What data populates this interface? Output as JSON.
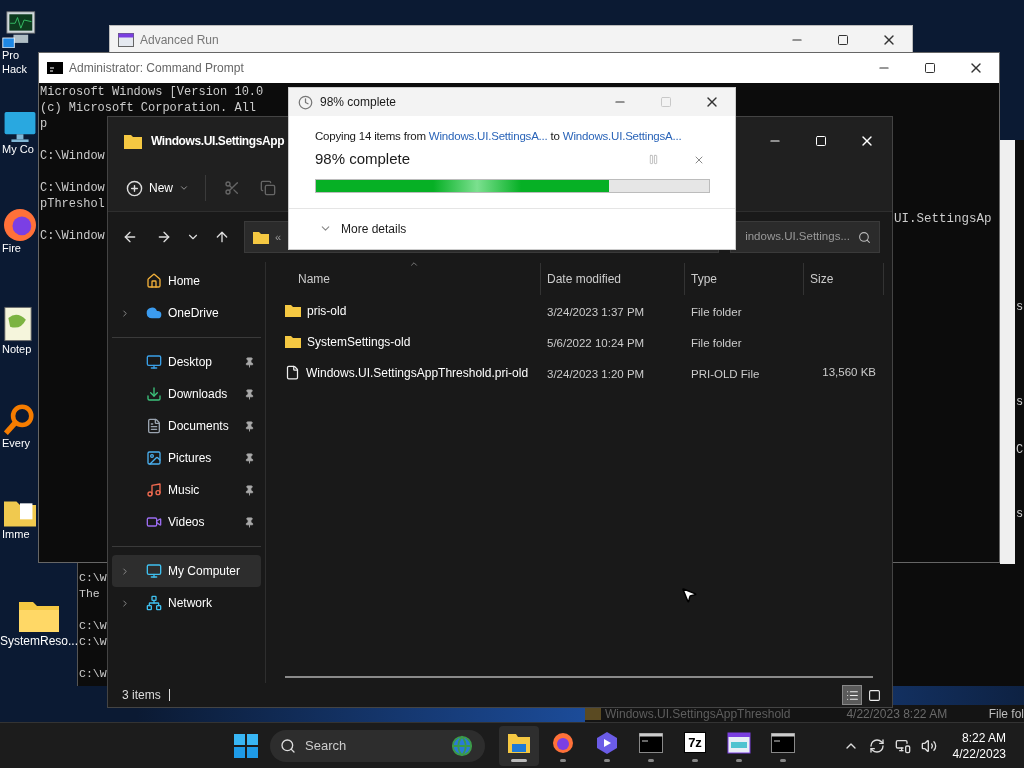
{
  "desktop_icons": [
    {
      "kind": "monitor-app",
      "label_lines": [
        "Pro",
        "Hack"
      ]
    },
    {
      "kind": "monitor",
      "label_lines": [
        "My Co"
      ]
    },
    {
      "kind": "browser",
      "label_lines": [
        "Fire"
      ]
    },
    {
      "kind": "notepad",
      "label_lines": [
        "Notep"
      ]
    },
    {
      "kind": "magnifier",
      "label_lines": [
        "Every"
      ]
    },
    {
      "kind": "folder-doc",
      "label_lines": [
        "Imme"
      ]
    },
    {
      "kind": "folder",
      "label_lines": [
        "SystemReso..."
      ]
    }
  ],
  "advanced_run": {
    "title": "Advanced Run"
  },
  "command_prompt": {
    "title": "Administrator: Command Prompt",
    "lines": [
      {
        "kind": "text",
        "text": "Microsoft Windows [Version 10.0"
      },
      {
        "kind": "text",
        "text": "(c) Microsoft Corporation. All"
      },
      {
        "kind": "text",
        "text": "p"
      },
      {
        "kind": "blank"
      },
      {
        "kind": "text",
        "text": "C:\\Window"
      },
      {
        "kind": "blank"
      },
      {
        "kind": "text",
        "text": "C:\\Window"
      },
      {
        "kind": "text",
        "text": "pThreshol"
      },
      {
        "kind": "blank"
      },
      {
        "kind": "text",
        "text": "C:\\Window"
      }
    ],
    "right_text": "UI.SettingsAp"
  },
  "lower_console": {
    "lines": [
      {
        "kind": "text",
        "text": "C:\\W"
      },
      {
        "kind": "text",
        "text": "The"
      },
      {
        "kind": "blank"
      },
      {
        "kind": "text",
        "text": "C:\\W"
      },
      {
        "kind": "text",
        "text": "C:\\W"
      },
      {
        "kind": "blank"
      },
      {
        "kind": "text",
        "text": "C:\\W"
      }
    ]
  },
  "edge_window": {
    "fragments": [
      "s",
      "s",
      "C",
      "s"
    ]
  },
  "background_row": {
    "name": "Windows.UI.SettingsAppThreshold",
    "date": "4/22/2023 8:22 AM",
    "type": "File fol"
  },
  "explorer": {
    "title": "Windows.UI.SettingsApp",
    "new_label": "New",
    "address_prefix": "«",
    "search_text": "indows.UI.Settings...",
    "sidebar": [
      {
        "items": [
          {
            "label": "Home",
            "kind": "home",
            "expandable": false,
            "pinned": false,
            "selected": false
          },
          {
            "label": "OneDrive",
            "kind": "cloud",
            "expandable": true,
            "pinned": false,
            "selected": false
          }
        ]
      },
      {
        "items": [
          {
            "label": "Desktop",
            "kind": "desktop",
            "expandable": false,
            "pinned": true,
            "selected": false
          },
          {
            "label": "Downloads",
            "kind": "download",
            "expandable": false,
            "pinned": true,
            "selected": false
          },
          {
            "label": "Documents",
            "kind": "document",
            "expandable": false,
            "pinned": true,
            "selected": false
          },
          {
            "label": "Pictures",
            "kind": "picture",
            "expandable": false,
            "pinned": true,
            "selected": false
          },
          {
            "label": "Music",
            "kind": "music",
            "expandable": false,
            "pinned": true,
            "selected": false
          },
          {
            "label": "Videos",
            "kind": "video",
            "expandable": false,
            "pinned": true,
            "selected": false
          }
        ]
      },
      {
        "items": [
          {
            "label": "My Computer",
            "kind": "computer",
            "expandable": true,
            "pinned": false,
            "selected": true
          },
          {
            "label": "Network",
            "kind": "network",
            "expandable": true,
            "pinned": false,
            "selected": false
          }
        ]
      }
    ],
    "columns": [
      "Name",
      "Date modified",
      "Type",
      "Size"
    ],
    "rows": [
      {
        "kind": "folder",
        "name": "pris-old",
        "date": "3/24/2023 1:37 PM",
        "type": "File folder"
      },
      {
        "kind": "folder",
        "name": "SystemSettings-old",
        "date": "5/6/2022 10:24 PM",
        "type": "File folder"
      },
      {
        "kind": "file",
        "name": "Windows.UI.SettingsAppThreshold.pri-old",
        "date": "3/24/2023 1:20 PM",
        "type": "PRI-OLD File",
        "size": "13,560 KB"
      }
    ],
    "status": "3 items",
    "view_buttons": [
      {
        "kind": "details",
        "selected": true
      },
      {
        "kind": "tiles",
        "selected": false
      }
    ]
  },
  "dialog": {
    "title": "98% complete",
    "maximize_disabled": true,
    "copy_prefix": "Copying 14 items from",
    "source": "Windows.UI.SettingsA...",
    "copy_middle": "to",
    "destination": "Windows.UI.SettingsA...",
    "heading": "98% complete",
    "progress": {
      "level": 0.745
    },
    "details_label": "More details"
  },
  "taskbar": {
    "search_label": "Search",
    "apps": [
      {
        "kind": "files",
        "active": true
      },
      {
        "kind": "browser",
        "active": false
      },
      {
        "kind": "copilot",
        "active": false
      },
      {
        "kind": "terminal",
        "active": false
      },
      {
        "kind": "archive",
        "label": "7z",
        "active": false
      },
      {
        "kind": "window",
        "active": false
      },
      {
        "kind": "terminal",
        "active": false
      }
    ],
    "time": "8:22 AM",
    "date": "4/22/2023"
  }
}
